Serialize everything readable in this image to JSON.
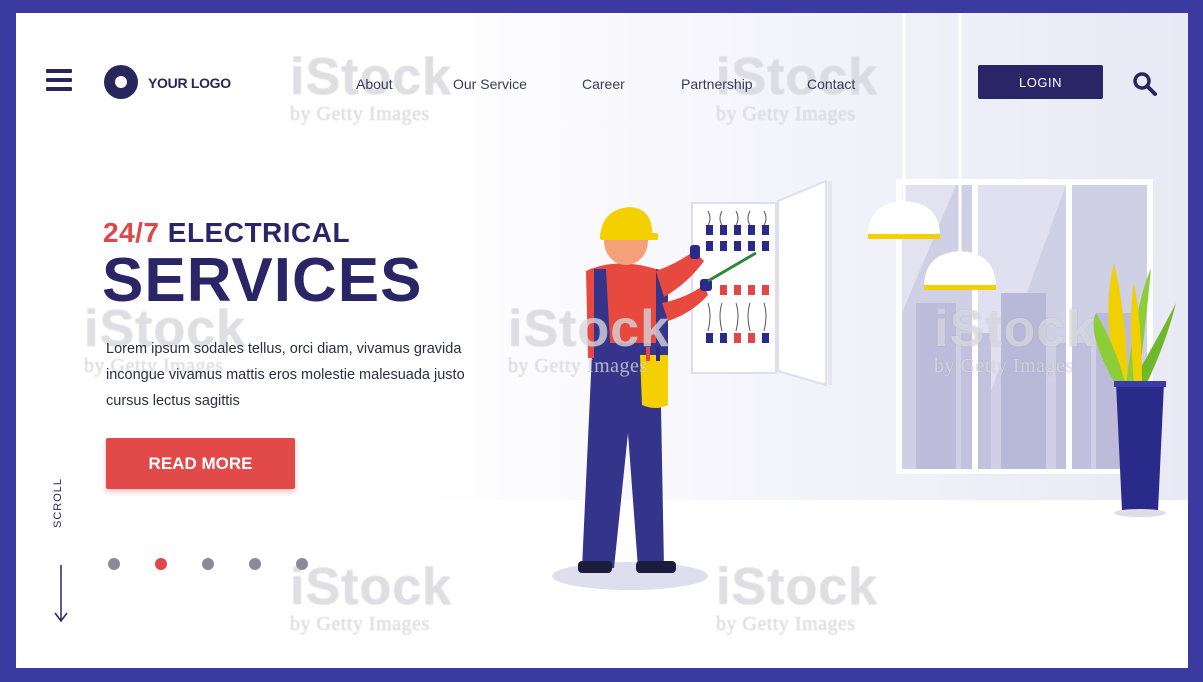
{
  "header": {
    "logo_text": "YOUR LOGO",
    "nav": [
      "About",
      "Our Service",
      "Career",
      "Partnership",
      "Contact"
    ],
    "login_label": "LOGIN"
  },
  "hero": {
    "title_accent": "24/7",
    "title_rest": "ELECTRICAL",
    "title_big": "SERVICES",
    "description": "Lorem ipsum sodales tellus, orci diam, vivamus gravida incongue vivamus mattis eros molestie malesuada justo cursus lectus sagittis",
    "button_label": "READ MORE"
  },
  "scroll": {
    "label": "SCROLL"
  },
  "pagination": {
    "count": 5,
    "active": 2
  },
  "watermark": {
    "brand": "iStock",
    "by": "by Getty Images"
  },
  "colors": {
    "primary": "#2a2566",
    "accent": "#e24646",
    "border": "#3a3aa0",
    "lamp": "#f5d000",
    "worker_shirt": "#e8493f",
    "worker_overalls": "#34348a"
  }
}
